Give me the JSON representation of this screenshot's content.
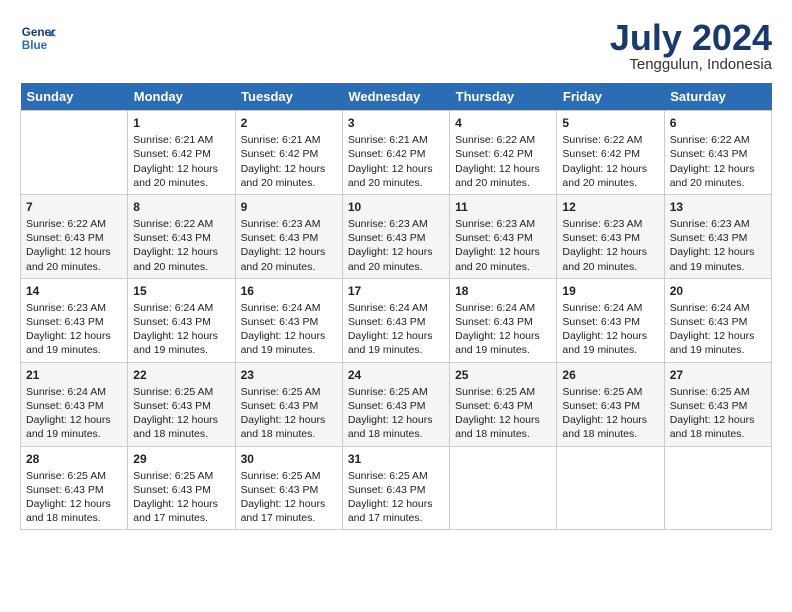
{
  "header": {
    "logo_line1": "General",
    "logo_line2": "Blue",
    "month": "July 2024",
    "location": "Tenggulun, Indonesia"
  },
  "days_of_week": [
    "Sunday",
    "Monday",
    "Tuesday",
    "Wednesday",
    "Thursday",
    "Friday",
    "Saturday"
  ],
  "weeks": [
    [
      {
        "day": "",
        "info": ""
      },
      {
        "day": "1",
        "info": "Sunrise: 6:21 AM\nSunset: 6:42 PM\nDaylight: 12 hours\nand 20 minutes."
      },
      {
        "day": "2",
        "info": "Sunrise: 6:21 AM\nSunset: 6:42 PM\nDaylight: 12 hours\nand 20 minutes."
      },
      {
        "day": "3",
        "info": "Sunrise: 6:21 AM\nSunset: 6:42 PM\nDaylight: 12 hours\nand 20 minutes."
      },
      {
        "day": "4",
        "info": "Sunrise: 6:22 AM\nSunset: 6:42 PM\nDaylight: 12 hours\nand 20 minutes."
      },
      {
        "day": "5",
        "info": "Sunrise: 6:22 AM\nSunset: 6:42 PM\nDaylight: 12 hours\nand 20 minutes."
      },
      {
        "day": "6",
        "info": "Sunrise: 6:22 AM\nSunset: 6:43 PM\nDaylight: 12 hours\nand 20 minutes."
      }
    ],
    [
      {
        "day": "7",
        "info": "Sunrise: 6:22 AM\nSunset: 6:43 PM\nDaylight: 12 hours\nand 20 minutes."
      },
      {
        "day": "8",
        "info": "Sunrise: 6:22 AM\nSunset: 6:43 PM\nDaylight: 12 hours\nand 20 minutes."
      },
      {
        "day": "9",
        "info": "Sunrise: 6:23 AM\nSunset: 6:43 PM\nDaylight: 12 hours\nand 20 minutes."
      },
      {
        "day": "10",
        "info": "Sunrise: 6:23 AM\nSunset: 6:43 PM\nDaylight: 12 hours\nand 20 minutes."
      },
      {
        "day": "11",
        "info": "Sunrise: 6:23 AM\nSunset: 6:43 PM\nDaylight: 12 hours\nand 20 minutes."
      },
      {
        "day": "12",
        "info": "Sunrise: 6:23 AM\nSunset: 6:43 PM\nDaylight: 12 hours\nand 20 minutes."
      },
      {
        "day": "13",
        "info": "Sunrise: 6:23 AM\nSunset: 6:43 PM\nDaylight: 12 hours\nand 19 minutes."
      }
    ],
    [
      {
        "day": "14",
        "info": "Sunrise: 6:23 AM\nSunset: 6:43 PM\nDaylight: 12 hours\nand 19 minutes."
      },
      {
        "day": "15",
        "info": "Sunrise: 6:24 AM\nSunset: 6:43 PM\nDaylight: 12 hours\nand 19 minutes."
      },
      {
        "day": "16",
        "info": "Sunrise: 6:24 AM\nSunset: 6:43 PM\nDaylight: 12 hours\nand 19 minutes."
      },
      {
        "day": "17",
        "info": "Sunrise: 6:24 AM\nSunset: 6:43 PM\nDaylight: 12 hours\nand 19 minutes."
      },
      {
        "day": "18",
        "info": "Sunrise: 6:24 AM\nSunset: 6:43 PM\nDaylight: 12 hours\nand 19 minutes."
      },
      {
        "day": "19",
        "info": "Sunrise: 6:24 AM\nSunset: 6:43 PM\nDaylight: 12 hours\nand 19 minutes."
      },
      {
        "day": "20",
        "info": "Sunrise: 6:24 AM\nSunset: 6:43 PM\nDaylight: 12 hours\nand 19 minutes."
      }
    ],
    [
      {
        "day": "21",
        "info": "Sunrise: 6:24 AM\nSunset: 6:43 PM\nDaylight: 12 hours\nand 19 minutes."
      },
      {
        "day": "22",
        "info": "Sunrise: 6:25 AM\nSunset: 6:43 PM\nDaylight: 12 hours\nand 18 minutes."
      },
      {
        "day": "23",
        "info": "Sunrise: 6:25 AM\nSunset: 6:43 PM\nDaylight: 12 hours\nand 18 minutes."
      },
      {
        "day": "24",
        "info": "Sunrise: 6:25 AM\nSunset: 6:43 PM\nDaylight: 12 hours\nand 18 minutes."
      },
      {
        "day": "25",
        "info": "Sunrise: 6:25 AM\nSunset: 6:43 PM\nDaylight: 12 hours\nand 18 minutes."
      },
      {
        "day": "26",
        "info": "Sunrise: 6:25 AM\nSunset: 6:43 PM\nDaylight: 12 hours\nand 18 minutes."
      },
      {
        "day": "27",
        "info": "Sunrise: 6:25 AM\nSunset: 6:43 PM\nDaylight: 12 hours\nand 18 minutes."
      }
    ],
    [
      {
        "day": "28",
        "info": "Sunrise: 6:25 AM\nSunset: 6:43 PM\nDaylight: 12 hours\nand 18 minutes."
      },
      {
        "day": "29",
        "info": "Sunrise: 6:25 AM\nSunset: 6:43 PM\nDaylight: 12 hours\nand 17 minutes."
      },
      {
        "day": "30",
        "info": "Sunrise: 6:25 AM\nSunset: 6:43 PM\nDaylight: 12 hours\nand 17 minutes."
      },
      {
        "day": "31",
        "info": "Sunrise: 6:25 AM\nSunset: 6:43 PM\nDaylight: 12 hours\nand 17 minutes."
      },
      {
        "day": "",
        "info": ""
      },
      {
        "day": "",
        "info": ""
      },
      {
        "day": "",
        "info": ""
      }
    ]
  ]
}
